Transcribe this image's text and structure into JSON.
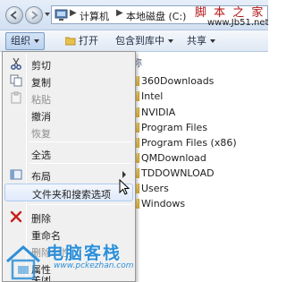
{
  "address_bar": {
    "breadcrumbs": [
      "计算机",
      "本地磁盘 (C:)"
    ],
    "separator": "▶"
  },
  "watermark_top": {
    "title": "脚 本 之 家",
    "url": "www.Jb51.net"
  },
  "toolbar": {
    "organize": "组织",
    "open": "打开",
    "include_in_library": "包含到库中",
    "share": "共享"
  },
  "file_list": {
    "column_header": "称",
    "items": [
      "360Downloads",
      "Intel",
      "NVIDIA",
      "Program Files",
      "Program Files (x86)",
      "QMDownload",
      "TDDOWNLOAD",
      "Users",
      "Windows"
    ]
  },
  "menu": {
    "cut": "剪切",
    "copy": "复制",
    "paste": "粘贴",
    "undo": "撤消",
    "redo": "恢复",
    "select_all": "全选",
    "layout": "布局",
    "folder_options": "文件夹和搜索选项",
    "delete": "删除",
    "rename": "重命名",
    "remove_properties": "删除属性",
    "properties": "属性",
    "close": "关闭"
  },
  "watermark_bottom": {
    "title": "电脑客栈",
    "url": "www.pckezhan.com"
  },
  "colors": {
    "accent": "#2d8fd9",
    "watermark_red": "#b21414",
    "toolbar_bg": "#dfe8f4"
  }
}
